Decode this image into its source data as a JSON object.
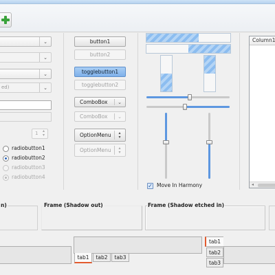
{
  "toolbar": {
    "add_icon": "add-icon"
  },
  "left": {
    "combo_texts": [
      "",
      "",
      "",
      "ed)"
    ],
    "spin_value": "1",
    "radios": [
      {
        "label": "radiobutton1",
        "checked": false,
        "disabled": false
      },
      {
        "label": "radiobutton2",
        "checked": true,
        "disabled": false
      },
      {
        "label": "radiobutton3",
        "checked": false,
        "disabled": true
      },
      {
        "label": "radiobutton4",
        "checked": true,
        "disabled": true
      }
    ]
  },
  "buttons": {
    "button1": "button1",
    "button2": "button2",
    "toggle1": "togglebutton1",
    "toggle2": "togglebutton2",
    "combo1": "ComboBox",
    "combo2": "ComboBox",
    "option1": "OptionMenu",
    "option2": "OptionMenu"
  },
  "progress": {
    "hbar1": 0.62,
    "hbar2": 0.5,
    "vbar1": 0.5,
    "vbar2": 0.5
  },
  "scales": {
    "h1": 0.52,
    "h2": 0.46,
    "v1": 0.45,
    "v2": 0.45
  },
  "harmony": {
    "label": "Move In Harmony",
    "checked": true
  },
  "tree": {
    "column": "Column1"
  },
  "frames": [
    {
      "title": "n)"
    },
    {
      "title": "Frame (Shadow out)"
    },
    {
      "title": "Frame (Shadow etched in)"
    }
  ],
  "notebook_bottom": {
    "tabs": [
      "tab1",
      "tab2",
      "tab3"
    ],
    "selected": 0
  },
  "notebook_left": {
    "tabs": [
      "tab1",
      "tab2",
      "tab3"
    ],
    "selected": 0
  },
  "colors": {
    "accent": "#5d97e0",
    "tab_highlight": "#e25a2e",
    "add": "#3aa23a"
  }
}
